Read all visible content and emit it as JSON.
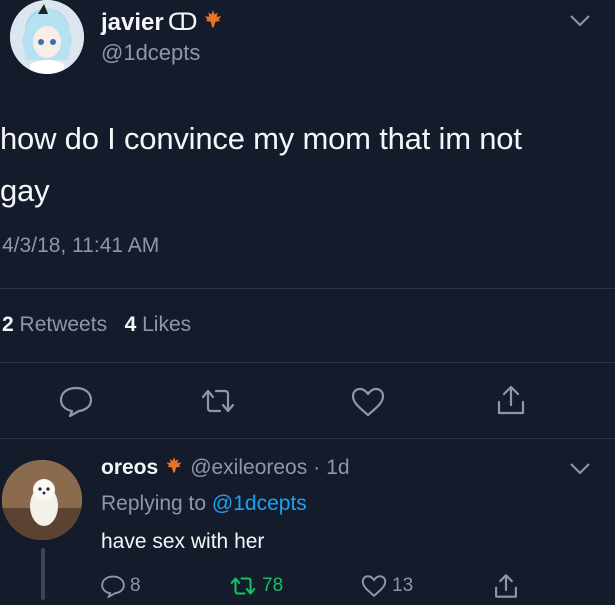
{
  "tweet": {
    "author_name": "javier",
    "author_name_symbol": "ↀ",
    "author_handle": "@1dcepts",
    "text_line1": "how do I convince my mom that im not",
    "text_line2": "gay",
    "timestamp": "4/3/18, 11:41 AM",
    "retweets_count": "2",
    "retweets_label": "Retweets",
    "likes_count": "4",
    "likes_label": "Likes"
  },
  "reply": {
    "author_name": "oreos",
    "author_handle": "@exileoreos",
    "separator": "·",
    "age": "1d",
    "replying_prefix": "Replying to",
    "replying_to": "@1dcepts",
    "text": "have sex with her",
    "reply_count": "8",
    "retweet_count": "78",
    "like_count": "13"
  },
  "colors": {
    "background": "#141b2a",
    "text": "#f4f6f9",
    "muted": "#8c98a8",
    "link": "#1da1f2",
    "retweet_green": "#17bf63",
    "maple": "#e8742a"
  },
  "icons": [
    "chevron-down-icon",
    "maple-leaf-icon",
    "reply-icon",
    "retweet-icon",
    "like-icon",
    "share-icon"
  ]
}
